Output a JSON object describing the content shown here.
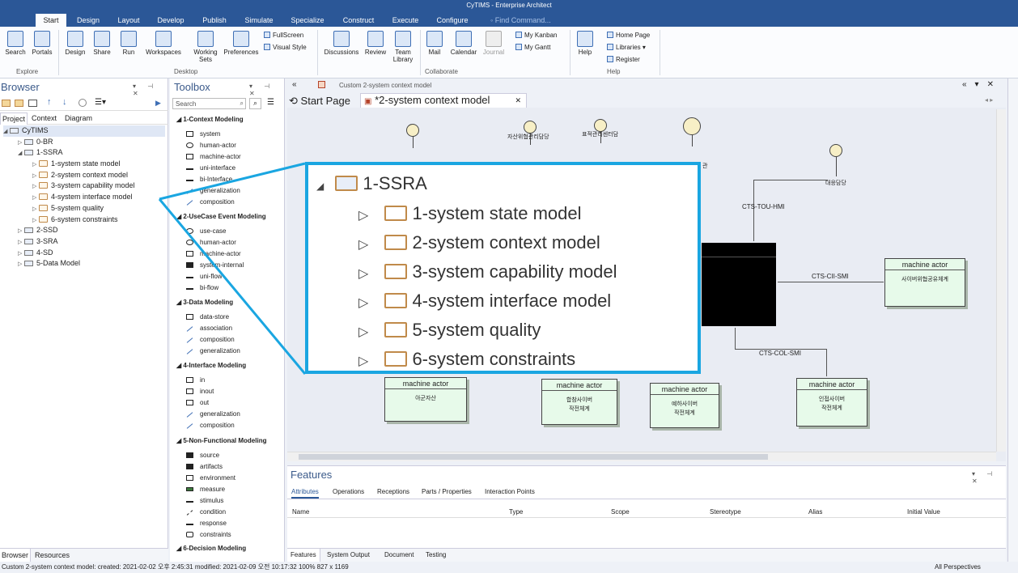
{
  "window": {
    "title": "CyTIMS - Enterprise Architect"
  },
  "ribbon_tabs": [
    "Start",
    "Design",
    "Layout",
    "Develop",
    "Publish",
    "Simulate",
    "Specialize",
    "Construct",
    "Execute",
    "Configure"
  ],
  "find_command": "Find Command...",
  "ribbon": {
    "explore": {
      "search": "Search",
      "portals": "Portals",
      "group": "Explore"
    },
    "desktop": {
      "design": "Design",
      "share": "Share",
      "run": "Run",
      "workspaces": "Workspaces",
      "working_sets": "Working Sets",
      "preferences": "Preferences",
      "fullscreen": "FullScreen",
      "visual_style": "Visual Style",
      "group": "Desktop"
    },
    "collaborate": {
      "discussions": "Discussions",
      "review": "Review",
      "team_library": "Team Library",
      "mail": "Mail",
      "calendar": "Calendar",
      "journal": "Journal",
      "my_kanban": "My Kanban",
      "my_gantt": "My Gantt",
      "group": "Collaborate"
    },
    "help": {
      "help": "Help",
      "home_page": "Home Page",
      "libraries": "Libraries",
      "register": "Register",
      "group": "Help"
    }
  },
  "browser": {
    "title": "Browser",
    "tabs": [
      "Project",
      "Context",
      "Diagram"
    ],
    "root": "CyTIMS",
    "items": [
      "0-BR",
      "1-SSRA",
      "2-SSD",
      "3-SRA",
      "4-SD",
      "5-Data Model"
    ],
    "ssra_children": [
      "1-system state model",
      "2-system context model",
      "3-system capability model",
      "4-system interface model",
      "5-system quality",
      "6-system constraints"
    ],
    "bottom_tabs": [
      "Browser",
      "Resources"
    ]
  },
  "toolbox": {
    "title": "Toolbox",
    "search_placeholder": "Search",
    "sections": [
      {
        "title": "1-Context Modeling",
        "items": [
          "system",
          "human-actor",
          "machine-actor",
          "uni-interface",
          "bi-Interface",
          "generalization",
          "composition"
        ]
      },
      {
        "title": "2-UseCase Event Modeling",
        "items": [
          "use-case",
          "human-actor",
          "machine-actor",
          "system-internal",
          "uni-flow",
          "bi-flow"
        ]
      },
      {
        "title": "3-Data Modeling",
        "items": [
          "data-store",
          "association",
          "composition",
          "generalization"
        ]
      },
      {
        "title": "4-Interface Modeling",
        "items": [
          "in",
          "inout",
          "out",
          "generalization",
          "composition"
        ]
      },
      {
        "title": "5-Non-Functional Modeling",
        "items": [
          "source",
          "artifacts",
          "environment",
          "measure",
          "stimulus",
          "condition",
          "response",
          "constraints"
        ]
      },
      {
        "title": "6-Decision Modeling",
        "items": []
      }
    ]
  },
  "diagram": {
    "header_title": "Custom 2-system context model",
    "tabs": [
      "Start Page",
      "*2-system context model"
    ],
    "actors": [
      "자산위협관리담당",
      "표적관리센터담",
      "대응담당"
    ],
    "actor_partial": "관",
    "connectors": [
      "CTS-TOU-HMI",
      "CTS-CII-SMI",
      "CTS-COL-SMI"
    ],
    "machine_actors": [
      {
        "title": "machine actor",
        "sub": "사이버위협공유체계"
      },
      {
        "title": "machine actor",
        "sub": "아군자산"
      },
      {
        "title": "machine actor",
        "sub": "합참사이버\n작전체계"
      },
      {
        "title": "machine actor",
        "sub": "예하사이버\n작전체계"
      },
      {
        "title": "machine actor",
        "sub": "인접사이버\n작전체계"
      }
    ]
  },
  "zoom_callout": {
    "root": "1-SSRA",
    "items": [
      "1-system state model",
      "2-system context model",
      "3-system capability model",
      "4-system interface model",
      "5-system quality",
      "6-system constraints"
    ]
  },
  "features": {
    "title": "Features",
    "tabs": [
      "Attributes",
      "Operations",
      "Receptions",
      "Parts / Properties",
      "Interaction Points"
    ],
    "columns": [
      "Name",
      "Type",
      "Scope",
      "Stereotype",
      "Alias",
      "Initial Value"
    ]
  },
  "bottom_tabs": [
    "Features",
    "System Output",
    "Document",
    "Testing"
  ],
  "status": {
    "left": "Custom 2-system context model:  created: 2021-02-02 오후 2:45:31  modified: 2021-02-09 오전 10:17:32  100%  827 x 1169",
    "right": "All Perspectives"
  },
  "colors": {
    "ribbon_blue": "#2b5797",
    "callout_border": "#1aa6e1",
    "machine_actor_fill": "#e7faea"
  }
}
